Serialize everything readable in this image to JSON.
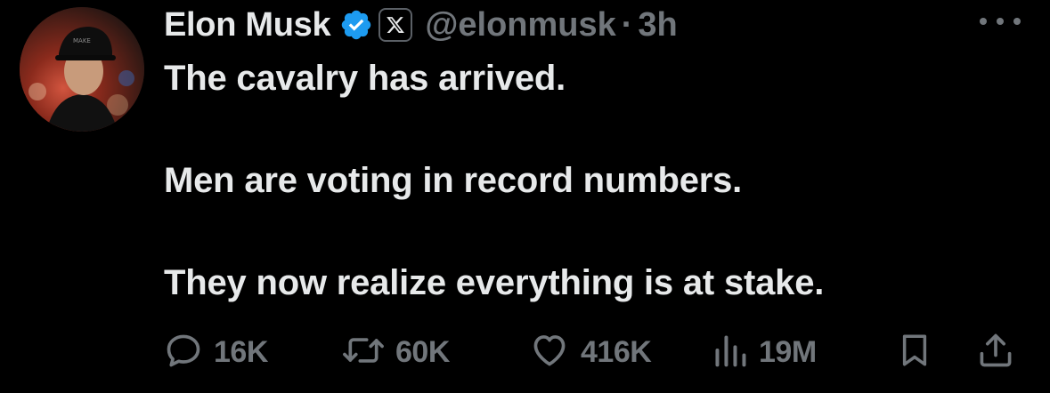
{
  "author": {
    "name": "Elon Musk",
    "handle": "@elonmusk",
    "separator": "·",
    "time": "3h",
    "verified_icon": "verified-badge-icon",
    "affiliation_icon": "x-logo-icon"
  },
  "tweet": {
    "lines": [
      "The cavalry has arrived.",
      "Men are voting in record numbers.",
      "They now realize everything is at stake."
    ]
  },
  "actions": {
    "reply": {
      "icon": "reply-icon",
      "count": "16K"
    },
    "retweet": {
      "icon": "retweet-icon",
      "count": "60K"
    },
    "like": {
      "icon": "heart-icon",
      "count": "416K"
    },
    "views": {
      "icon": "views-icon",
      "count": "19M"
    },
    "bookmark": {
      "icon": "bookmark-icon"
    },
    "share": {
      "icon": "share-icon"
    }
  },
  "colors": {
    "background": "#000000",
    "primary_text": "#e7e9ea",
    "secondary_text": "#71767b",
    "verified": "#1d9bf0"
  }
}
